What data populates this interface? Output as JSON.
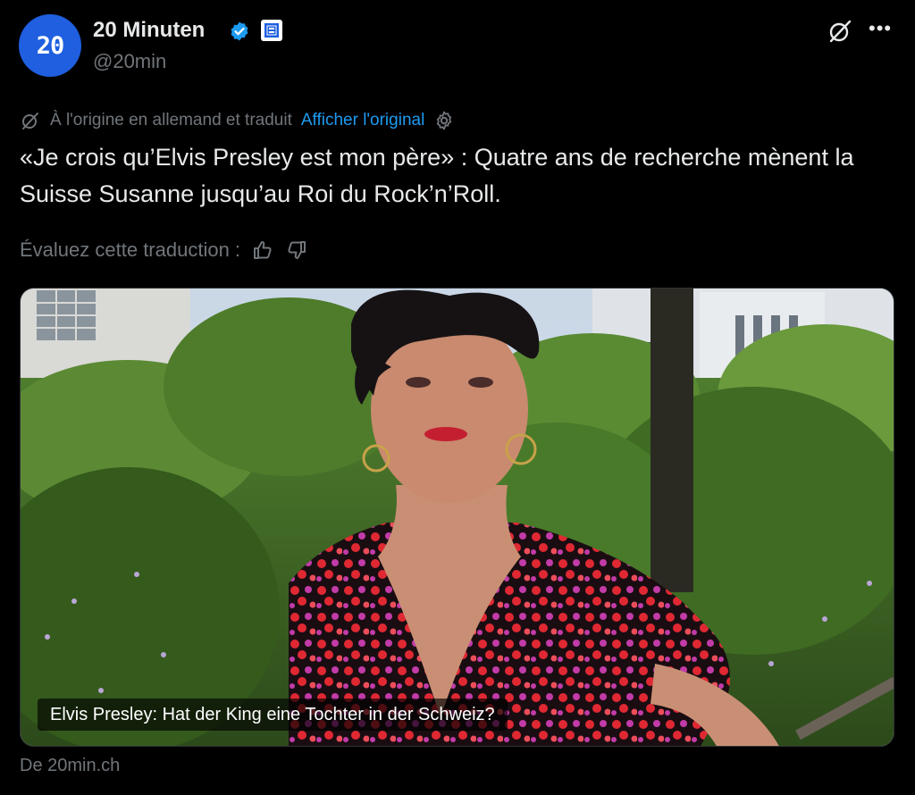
{
  "account": {
    "avatar_text": "20",
    "name": "20 Minuten",
    "handle": "@20min"
  },
  "translation": {
    "note": "À l'origine en allemand et traduit",
    "show_original": "Afficher l'original",
    "rate_label": "Évaluez cette traduction :"
  },
  "tweet": {
    "text": "«Je crois qu’Elvis Presley est mon père» : Quatre ans de recherche mènent la Suisse Susanne jusqu’au Roi du Rock’n’Roll."
  },
  "card": {
    "caption": "Elvis Presley: Hat der King eine Tochter in der Schweiz?",
    "source": "De 20min.ch"
  },
  "colors": {
    "background": "#000000",
    "text": "#e7e9ea",
    "muted": "#71767b",
    "link": "#1d9bf0",
    "avatar": "#1f5fe0",
    "verified": "#1d9bf0"
  },
  "icons": [
    "verified-badge-icon",
    "affiliate-badge-icon",
    "grok-icon",
    "more-icon",
    "translate-icon",
    "gear-icon",
    "thumbs-up-icon",
    "thumbs-down-icon"
  ]
}
